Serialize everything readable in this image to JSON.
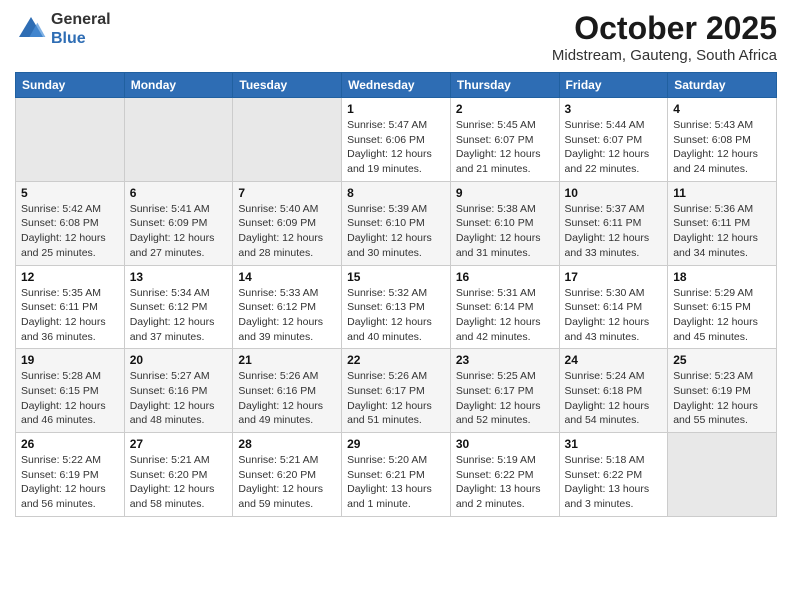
{
  "header": {
    "logo": {
      "general": "General",
      "blue": "Blue"
    },
    "month": "October 2025",
    "location": "Midstream, Gauteng, South Africa"
  },
  "weekdays": [
    "Sunday",
    "Monday",
    "Tuesday",
    "Wednesday",
    "Thursday",
    "Friday",
    "Saturday"
  ],
  "weeks": [
    [
      {
        "day": "",
        "sunrise": "",
        "sunset": "",
        "daylight": ""
      },
      {
        "day": "",
        "sunrise": "",
        "sunset": "",
        "daylight": ""
      },
      {
        "day": "",
        "sunrise": "",
        "sunset": "",
        "daylight": ""
      },
      {
        "day": "1",
        "sunrise": "Sunrise: 5:47 AM",
        "sunset": "Sunset: 6:06 PM",
        "daylight": "Daylight: 12 hours and 19 minutes."
      },
      {
        "day": "2",
        "sunrise": "Sunrise: 5:45 AM",
        "sunset": "Sunset: 6:07 PM",
        "daylight": "Daylight: 12 hours and 21 minutes."
      },
      {
        "day": "3",
        "sunrise": "Sunrise: 5:44 AM",
        "sunset": "Sunset: 6:07 PM",
        "daylight": "Daylight: 12 hours and 22 minutes."
      },
      {
        "day": "4",
        "sunrise": "Sunrise: 5:43 AM",
        "sunset": "Sunset: 6:08 PM",
        "daylight": "Daylight: 12 hours and 24 minutes."
      }
    ],
    [
      {
        "day": "5",
        "sunrise": "Sunrise: 5:42 AM",
        "sunset": "Sunset: 6:08 PM",
        "daylight": "Daylight: 12 hours and 25 minutes."
      },
      {
        "day": "6",
        "sunrise": "Sunrise: 5:41 AM",
        "sunset": "Sunset: 6:09 PM",
        "daylight": "Daylight: 12 hours and 27 minutes."
      },
      {
        "day": "7",
        "sunrise": "Sunrise: 5:40 AM",
        "sunset": "Sunset: 6:09 PM",
        "daylight": "Daylight: 12 hours and 28 minutes."
      },
      {
        "day": "8",
        "sunrise": "Sunrise: 5:39 AM",
        "sunset": "Sunset: 6:10 PM",
        "daylight": "Daylight: 12 hours and 30 minutes."
      },
      {
        "day": "9",
        "sunrise": "Sunrise: 5:38 AM",
        "sunset": "Sunset: 6:10 PM",
        "daylight": "Daylight: 12 hours and 31 minutes."
      },
      {
        "day": "10",
        "sunrise": "Sunrise: 5:37 AM",
        "sunset": "Sunset: 6:11 PM",
        "daylight": "Daylight: 12 hours and 33 minutes."
      },
      {
        "day": "11",
        "sunrise": "Sunrise: 5:36 AM",
        "sunset": "Sunset: 6:11 PM",
        "daylight": "Daylight: 12 hours and 34 minutes."
      }
    ],
    [
      {
        "day": "12",
        "sunrise": "Sunrise: 5:35 AM",
        "sunset": "Sunset: 6:11 PM",
        "daylight": "Daylight: 12 hours and 36 minutes."
      },
      {
        "day": "13",
        "sunrise": "Sunrise: 5:34 AM",
        "sunset": "Sunset: 6:12 PM",
        "daylight": "Daylight: 12 hours and 37 minutes."
      },
      {
        "day": "14",
        "sunrise": "Sunrise: 5:33 AM",
        "sunset": "Sunset: 6:12 PM",
        "daylight": "Daylight: 12 hours and 39 minutes."
      },
      {
        "day": "15",
        "sunrise": "Sunrise: 5:32 AM",
        "sunset": "Sunset: 6:13 PM",
        "daylight": "Daylight: 12 hours and 40 minutes."
      },
      {
        "day": "16",
        "sunrise": "Sunrise: 5:31 AM",
        "sunset": "Sunset: 6:14 PM",
        "daylight": "Daylight: 12 hours and 42 minutes."
      },
      {
        "day": "17",
        "sunrise": "Sunrise: 5:30 AM",
        "sunset": "Sunset: 6:14 PM",
        "daylight": "Daylight: 12 hours and 43 minutes."
      },
      {
        "day": "18",
        "sunrise": "Sunrise: 5:29 AM",
        "sunset": "Sunset: 6:15 PM",
        "daylight": "Daylight: 12 hours and 45 minutes."
      }
    ],
    [
      {
        "day": "19",
        "sunrise": "Sunrise: 5:28 AM",
        "sunset": "Sunset: 6:15 PM",
        "daylight": "Daylight: 12 hours and 46 minutes."
      },
      {
        "day": "20",
        "sunrise": "Sunrise: 5:27 AM",
        "sunset": "Sunset: 6:16 PM",
        "daylight": "Daylight: 12 hours and 48 minutes."
      },
      {
        "day": "21",
        "sunrise": "Sunrise: 5:26 AM",
        "sunset": "Sunset: 6:16 PM",
        "daylight": "Daylight: 12 hours and 49 minutes."
      },
      {
        "day": "22",
        "sunrise": "Sunrise: 5:26 AM",
        "sunset": "Sunset: 6:17 PM",
        "daylight": "Daylight: 12 hours and 51 minutes."
      },
      {
        "day": "23",
        "sunrise": "Sunrise: 5:25 AM",
        "sunset": "Sunset: 6:17 PM",
        "daylight": "Daylight: 12 hours and 52 minutes."
      },
      {
        "day": "24",
        "sunrise": "Sunrise: 5:24 AM",
        "sunset": "Sunset: 6:18 PM",
        "daylight": "Daylight: 12 hours and 54 minutes."
      },
      {
        "day": "25",
        "sunrise": "Sunrise: 5:23 AM",
        "sunset": "Sunset: 6:19 PM",
        "daylight": "Daylight: 12 hours and 55 minutes."
      }
    ],
    [
      {
        "day": "26",
        "sunrise": "Sunrise: 5:22 AM",
        "sunset": "Sunset: 6:19 PM",
        "daylight": "Daylight: 12 hours and 56 minutes."
      },
      {
        "day": "27",
        "sunrise": "Sunrise: 5:21 AM",
        "sunset": "Sunset: 6:20 PM",
        "daylight": "Daylight: 12 hours and 58 minutes."
      },
      {
        "day": "28",
        "sunrise": "Sunrise: 5:21 AM",
        "sunset": "Sunset: 6:20 PM",
        "daylight": "Daylight: 12 hours and 59 minutes."
      },
      {
        "day": "29",
        "sunrise": "Sunrise: 5:20 AM",
        "sunset": "Sunset: 6:21 PM",
        "daylight": "Daylight: 13 hours and 1 minute."
      },
      {
        "day": "30",
        "sunrise": "Sunrise: 5:19 AM",
        "sunset": "Sunset: 6:22 PM",
        "daylight": "Daylight: 13 hours and 2 minutes."
      },
      {
        "day": "31",
        "sunrise": "Sunrise: 5:18 AM",
        "sunset": "Sunset: 6:22 PM",
        "daylight": "Daylight: 13 hours and 3 minutes."
      },
      {
        "day": "",
        "sunrise": "",
        "sunset": "",
        "daylight": ""
      }
    ]
  ]
}
